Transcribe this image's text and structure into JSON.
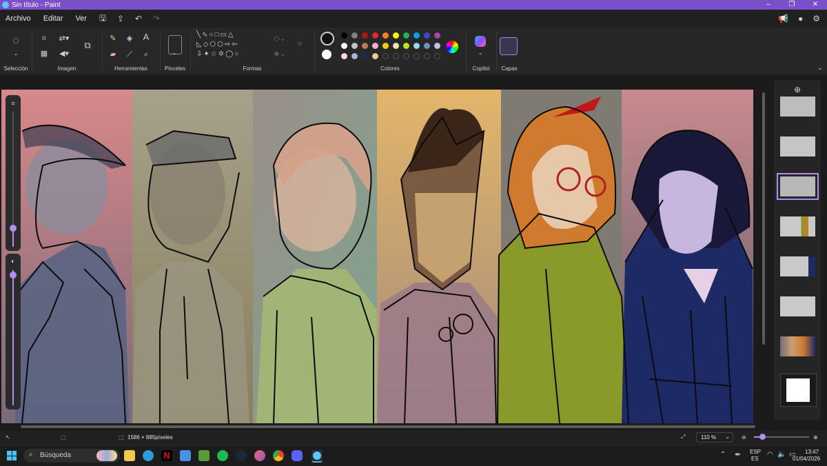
{
  "window": {
    "title": "Sin título - Paint",
    "minimize_glyph": "–",
    "maximize_glyph": "❐",
    "close_glyph": "✕"
  },
  "menu": {
    "file": "Archivo",
    "edit": "Editar",
    "view": "Ver"
  },
  "ribbon": {
    "groups": {
      "selection": "Selección",
      "image": "Imagen",
      "tools": "Herramientas",
      "brushes": "Pinceles",
      "shapes": "Formas",
      "colors": "Colores",
      "copilot": "Copilot",
      "layers": "Capas"
    },
    "text_tool_glyph": "A",
    "primary_color": "#111111",
    "secondary_color": "#ffffff",
    "palette": [
      "#000000",
      "#7f7f7f",
      "#b5121b",
      "#e8232e",
      "#ff7f27",
      "#fff200",
      "#22b14c",
      "#00a2e8",
      "#3f48cc",
      "#a349a4",
      "#ffffff",
      "#c3c3c3",
      "#b97a57",
      "#ffaec9",
      "#ffc90e",
      "#efe4b0",
      "#b5e61d",
      "#99d9ea",
      "#7092be",
      "#c8bfe7",
      "#ffd4e6",
      "#9fb3d6",
      "#202a54",
      "#f0c89a",
      "#3a3a3a",
      "#3a3a3a",
      "#3a3a3a",
      "#3a3a3a",
      "#3a3a3a",
      "#3a3a3a"
    ]
  },
  "status": {
    "dimensions": "1586 × 885píxeles",
    "zoom": "110 %"
  },
  "taskbar": {
    "search_placeholder": "Búsqueda",
    "lang1": "ESP",
    "lang2": "ES",
    "time": "13:47",
    "date": "01/04/2026"
  },
  "panel_labels": {
    "add_layer": "⊕"
  }
}
